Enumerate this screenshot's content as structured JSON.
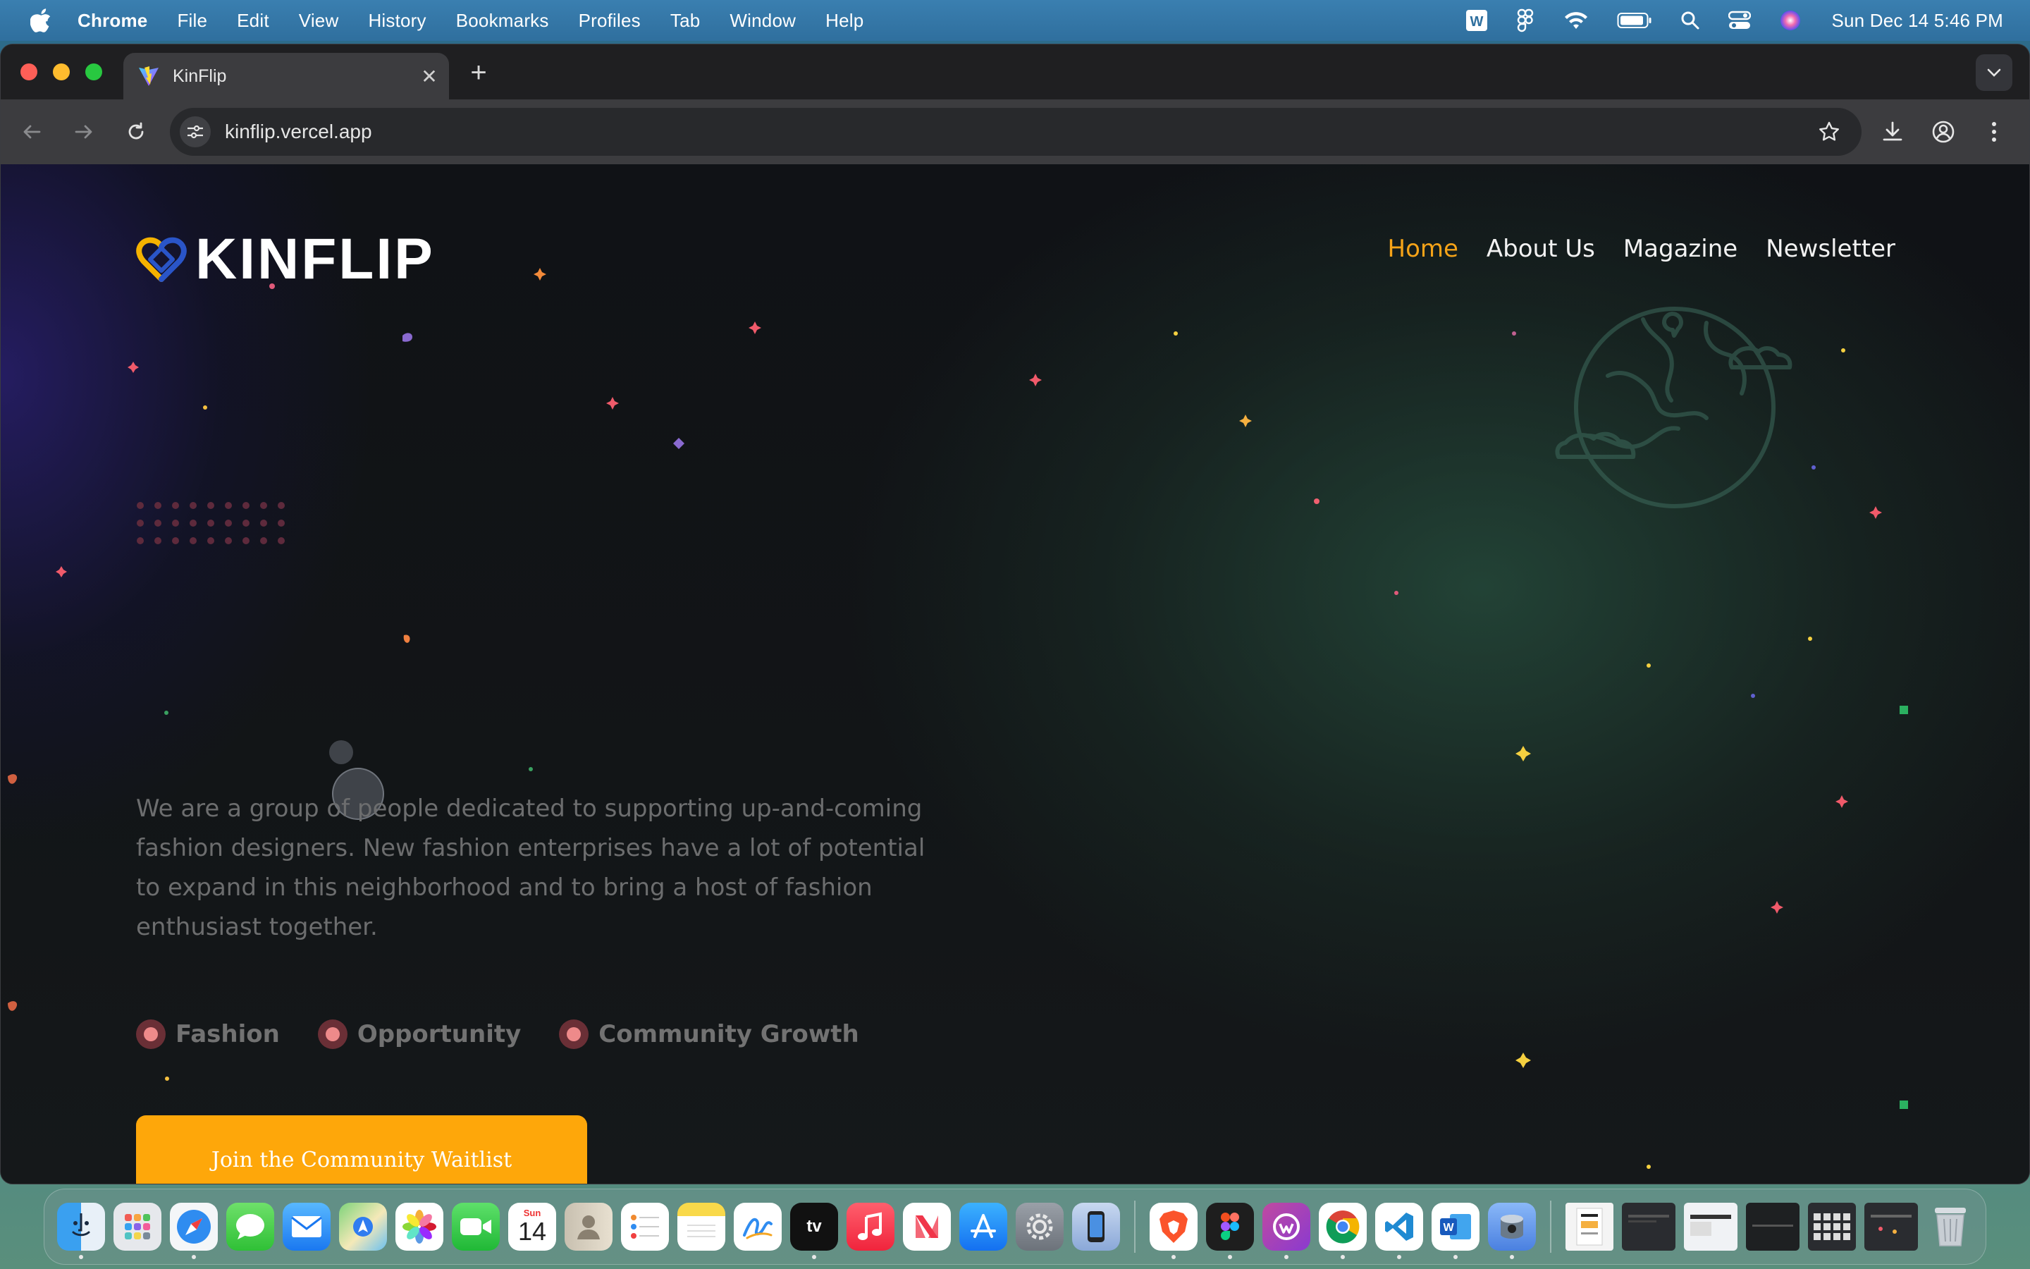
{
  "menubar": {
    "app_name": "Chrome",
    "items": [
      "File",
      "Edit",
      "View",
      "History",
      "Bookmarks",
      "Profiles",
      "Tab",
      "Window",
      "Help"
    ],
    "clock": "Sun Dec 14  5:46 PM"
  },
  "browser": {
    "tab_title": "KinFlip",
    "url": "kinflip.vercel.app"
  },
  "site": {
    "logo_text": "KINFLIP",
    "nav": [
      "Home",
      "About Us",
      "Magazine",
      "Newsletter"
    ],
    "active_nav": "Home",
    "hero_text": "We are a group of people dedicated to supporting up-and-coming fashion designers. New fashion enterprises have a lot of potential to expand in this neighborhood and to bring a host of fashion enthusiast together.",
    "tags": [
      "Fashion",
      "Opportunity",
      "Community Growth"
    ],
    "cta_label": "Join the Community Waitlist",
    "colors": {
      "accent": "#f5a318",
      "cta": "#fea70a",
      "tag_dot": "#ee8a8a"
    }
  },
  "dock": {
    "calendar_month": "Sun",
    "calendar_day": "14",
    "apps": [
      "finder",
      "launchpad",
      "safari",
      "messages",
      "mail",
      "maps",
      "photos",
      "facetime",
      "calendar",
      "contacts",
      "reminders",
      "notes",
      "freeform",
      "tv",
      "music",
      "news",
      "app-store",
      "system-settings",
      "simulator",
      "brave",
      "figma",
      "setapp",
      "chrome",
      "vscode",
      "word",
      "disk-utility"
    ]
  }
}
